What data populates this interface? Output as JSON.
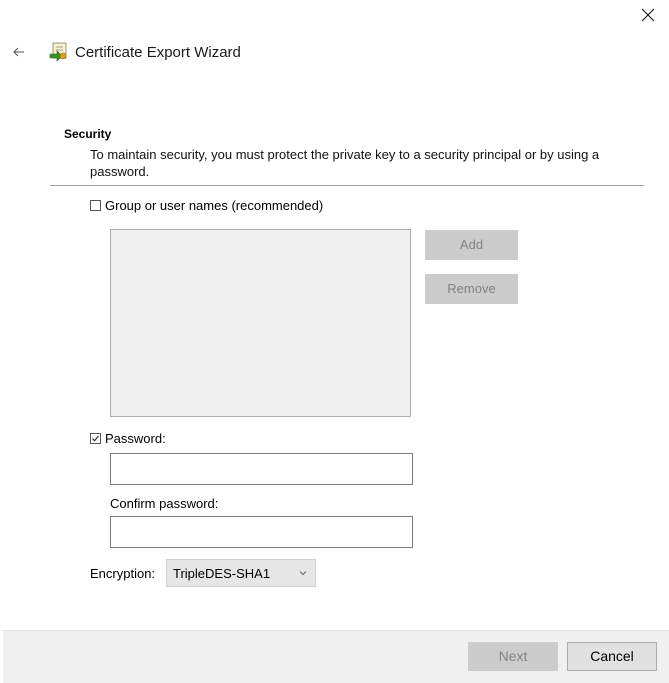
{
  "window": {
    "title": "Certificate Export Wizard",
    "back_icon": "back-arrow-icon",
    "close_icon": "close-icon"
  },
  "header": {
    "heading": "Security",
    "description": "To maintain security, you must protect the private key to a security principal or by using a password."
  },
  "group_option": {
    "label": "Group or user names (recommended)",
    "checked": false,
    "add_label": "Add",
    "remove_label": "Remove"
  },
  "password_option": {
    "label": "Password:",
    "checked": true,
    "password_value": "",
    "confirm_label": "Confirm password:",
    "confirm_value": ""
  },
  "encryption": {
    "label": "Encryption:",
    "selected": "TripleDES-SHA1"
  },
  "footer": {
    "next_label": "Next",
    "cancel_label": "Cancel"
  }
}
